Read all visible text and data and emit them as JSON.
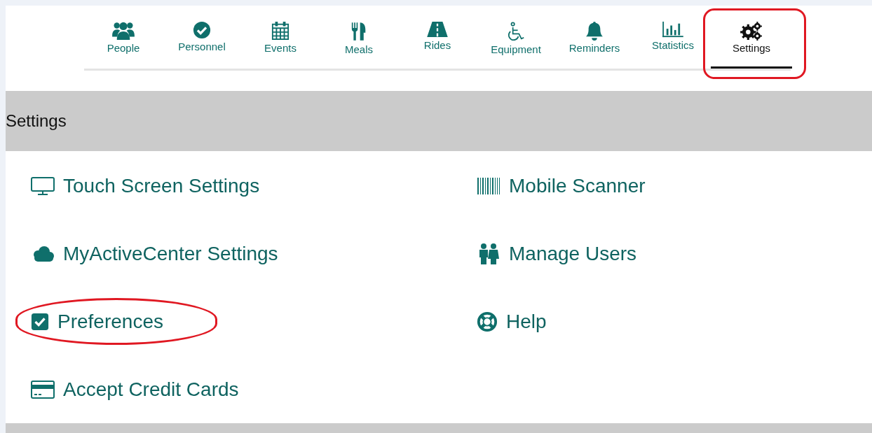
{
  "nav": [
    {
      "label": "People",
      "selected": false,
      "annotated": false
    },
    {
      "label": "Personnel",
      "selected": false,
      "annotated": false
    },
    {
      "label": "Events",
      "selected": false,
      "annotated": false
    },
    {
      "label": "Meals",
      "selected": false,
      "annotated": false
    },
    {
      "label": "Rides",
      "selected": false,
      "annotated": false
    },
    {
      "label": "Equipment",
      "selected": false,
      "annotated": false
    },
    {
      "label": "Reminders",
      "selected": false,
      "annotated": false
    },
    {
      "label": "Statistics",
      "selected": false,
      "annotated": false
    },
    {
      "label": "Settings",
      "selected": true,
      "annotated": true
    }
  ],
  "section": {
    "title": "Settings"
  },
  "links": [
    {
      "label": "Touch Screen Settings",
      "annotated": false
    },
    {
      "label": "Mobile Scanner",
      "annotated": false
    },
    {
      "label": "MyActiveCenter Settings",
      "annotated": false
    },
    {
      "label": "Manage Users",
      "annotated": false
    },
    {
      "label": "Preferences",
      "annotated": true
    },
    {
      "label": "Help",
      "annotated": false
    },
    {
      "label": "Accept Credit Cards",
      "annotated": false
    }
  ]
}
